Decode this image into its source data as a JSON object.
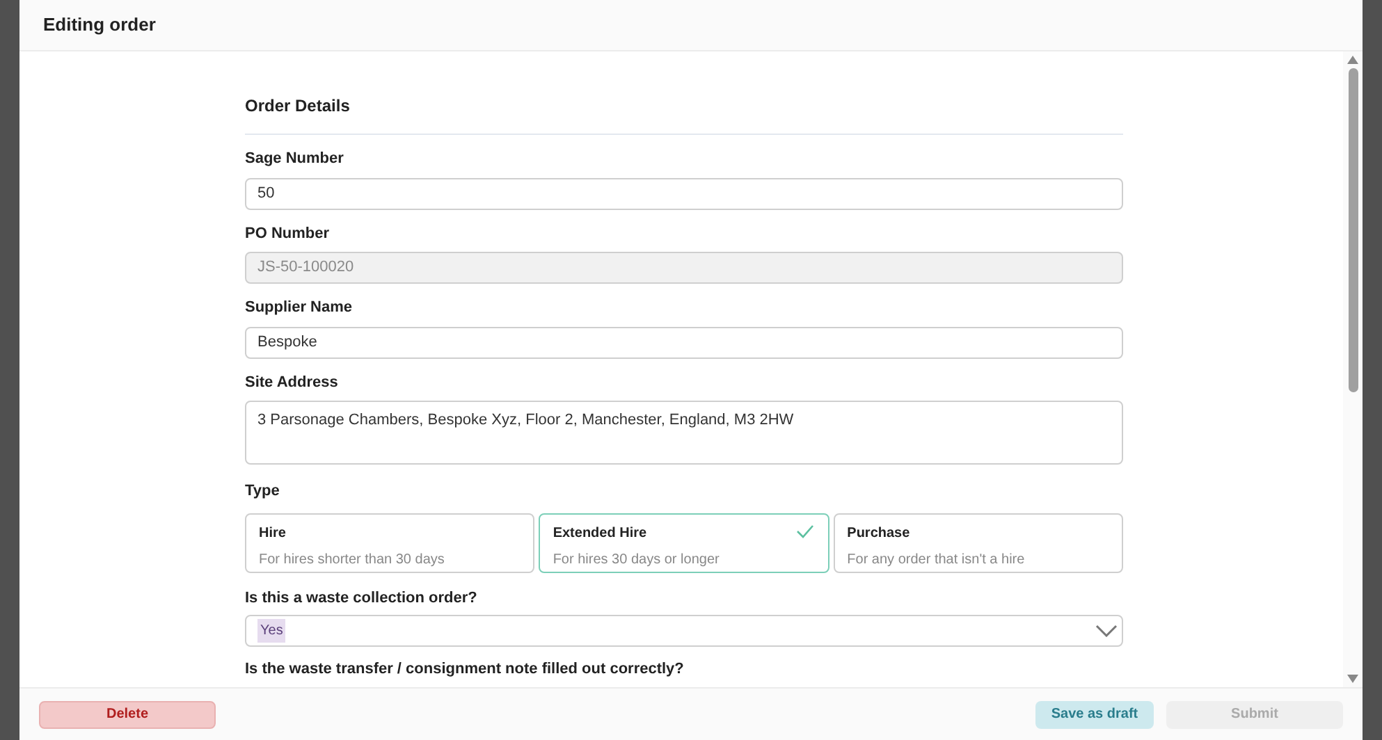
{
  "window": {
    "title": "Editing order"
  },
  "section": {
    "title": "Order Details"
  },
  "fields": [
    {
      "kind": "input",
      "label": "Sage Number",
      "value": "50",
      "disabled": false
    },
    {
      "kind": "input",
      "label": "PO Number",
      "value": "JS-50-100020",
      "disabled": true
    },
    {
      "kind": "input",
      "label": "Supplier Name",
      "value": "Bespoke",
      "disabled": false
    },
    {
      "kind": "textarea",
      "label": "Site Address",
      "value": "3 Parsonage Chambers, Bespoke Xyz, Floor 2, Manchester, England, M3 2HW",
      "disabled": false
    }
  ],
  "type": {
    "label": "Type",
    "options": [
      {
        "title": "Hire",
        "description": "For hires shorter than 30 days",
        "selected": false
      },
      {
        "title": "Extended Hire",
        "description": "For hires 30 days or longer",
        "selected": true
      },
      {
        "title": "Purchase",
        "description": "For any order that isn't a hire",
        "selected": false
      }
    ]
  },
  "waste_collection": {
    "label": "Is this a waste collection order?",
    "value": "Yes"
  },
  "next_question": {
    "label": "Is the waste transfer / consignment note filled out correctly?"
  },
  "footer": {
    "delete": "Delete",
    "save_draft": "Save as draft",
    "submit": {
      "label": "Submit",
      "disabled": true
    }
  }
}
